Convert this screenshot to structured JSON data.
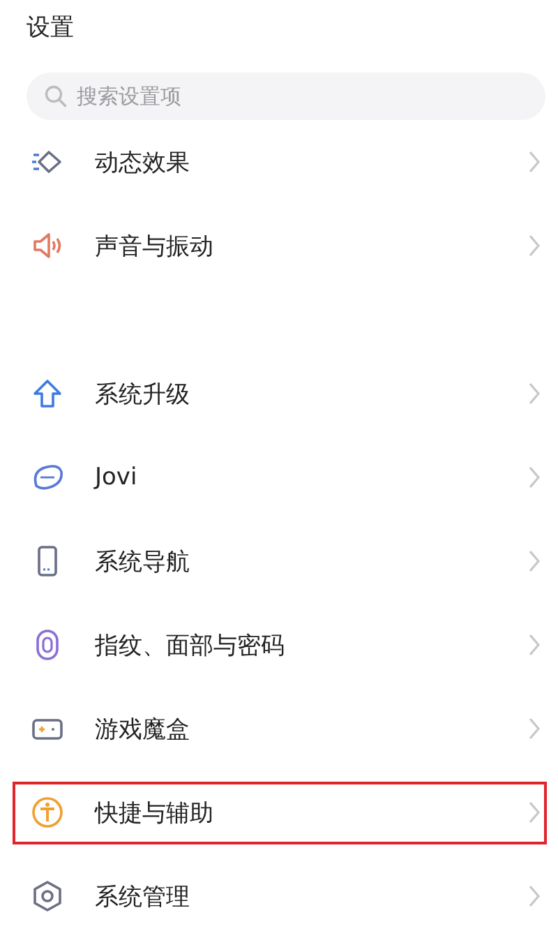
{
  "title": "设置",
  "search": {
    "placeholder": "搜索设置项"
  },
  "groups": [
    {
      "items": [
        {
          "label": "动态效果",
          "highlighted": false
        },
        {
          "label": "声音与振动",
          "highlighted": false
        }
      ]
    },
    {
      "items": [
        {
          "label": "系统升级",
          "highlighted": false
        },
        {
          "label": "Jovi",
          "highlighted": false
        },
        {
          "label": "系统导航",
          "highlighted": false
        },
        {
          "label": "指纹、面部与密码",
          "highlighted": false
        },
        {
          "label": "游戏魔盒",
          "highlighted": false
        },
        {
          "label": "快捷与辅助",
          "highlighted": true
        },
        {
          "label": "系统管理",
          "highlighted": false
        }
      ]
    }
  ]
}
